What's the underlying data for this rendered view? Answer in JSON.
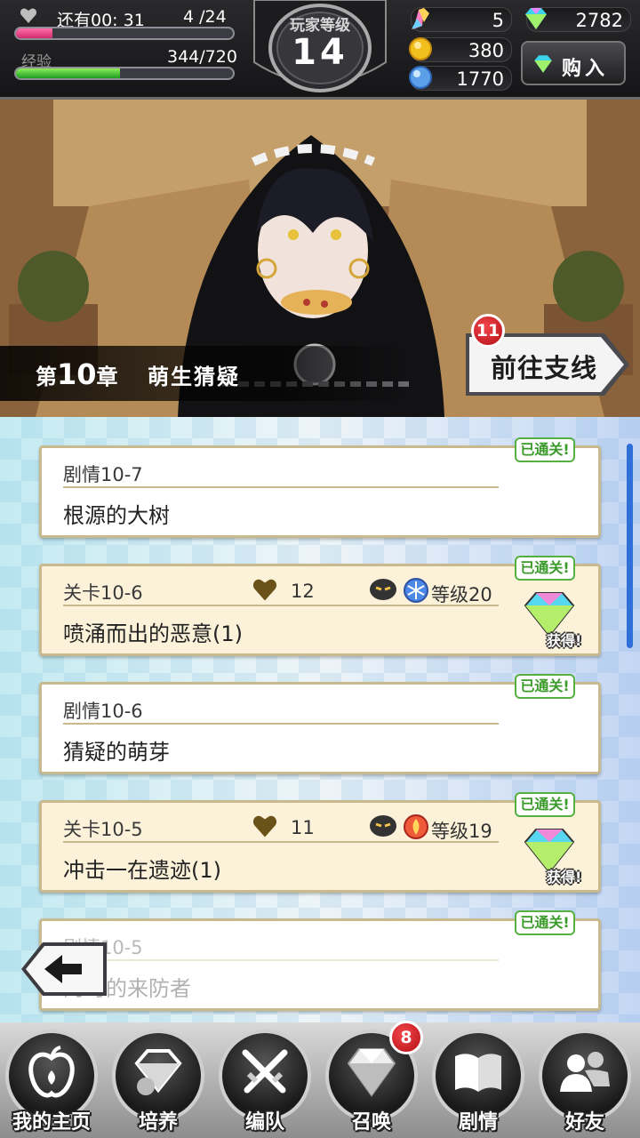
{
  "hud": {
    "stamina_label": "还有00: 31",
    "stamina_value": "4 /24",
    "stamina_fraction": 0.17,
    "exp_label": "经验",
    "exp_value": "344/720",
    "exp_fraction": 0.48,
    "level_title": "玩家等级",
    "level": "14",
    "resources": {
      "quartz": "5",
      "diamonds": "2782",
      "gold": "380",
      "orbs": "1770"
    },
    "buy_label": "购入"
  },
  "banner": {
    "chapter_prefix": "第",
    "chapter_number": "10",
    "chapter_suffix": "章",
    "chapter_name": "萌生猜疑",
    "side_story_label": "前往支线",
    "side_story_badge": "11"
  },
  "cleared_label": "已通关!",
  "obtained_label": "获得!",
  "entries": [
    {
      "type": "story",
      "title": "剧情10-7",
      "name": "根源的大树",
      "cleared": true
    },
    {
      "type": "stage",
      "title": "关卡10-6",
      "stamina": "12",
      "element": "ice",
      "level": "等级20",
      "name": "喷涌而出的恶意(1)",
      "cleared": true
    },
    {
      "type": "story",
      "title": "剧情10-6",
      "name": "猜疑的萌芽",
      "cleared": true
    },
    {
      "type": "stage",
      "title": "关卡10-5",
      "stamina": "11",
      "element": "fire",
      "level": "等级19",
      "name": "冲击一在遗迹(1)",
      "cleared": true
    },
    {
      "type": "story",
      "title": "剧情10-5",
      "name": "的时的来防者",
      "cleared": true
    }
  ],
  "nav": {
    "items": [
      {
        "label": "我的主页",
        "icon": "apple-icon"
      },
      {
        "label": "培养",
        "icon": "gem-cluster-icon"
      },
      {
        "label": "编队",
        "icon": "crossed-swords-icon"
      },
      {
        "label": "召唤",
        "icon": "diamond-icon",
        "badge": "8"
      },
      {
        "label": "剧情",
        "icon": "book-icon"
      },
      {
        "label": "好友",
        "icon": "friends-icon"
      }
    ]
  }
}
